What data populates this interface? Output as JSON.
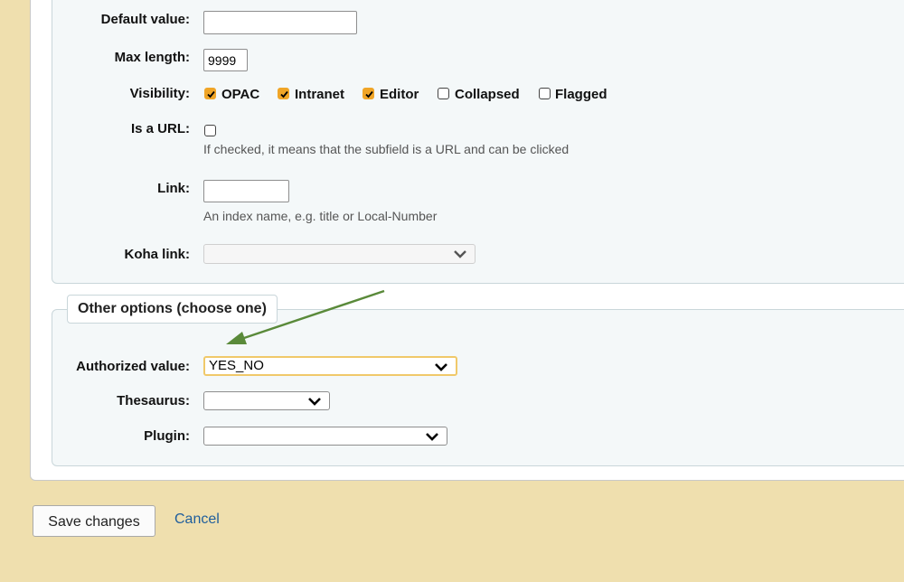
{
  "form": {
    "default_value": {
      "label": "Default value:",
      "value": ""
    },
    "max_length": {
      "label": "Max length:",
      "value": "9999"
    },
    "visibility": {
      "label": "Visibility:",
      "options": [
        {
          "label": "OPAC",
          "checked": true
        },
        {
          "label": "Intranet",
          "checked": true
        },
        {
          "label": "Editor",
          "checked": true
        },
        {
          "label": "Collapsed",
          "checked": false
        },
        {
          "label": "Flagged",
          "checked": false
        }
      ]
    },
    "is_url": {
      "label": "Is a URL:",
      "checked": false,
      "hint": "If checked, it means that the subfield is a URL and can be clicked"
    },
    "link": {
      "label": "Link:",
      "value": "",
      "hint": "An index name, e.g. title or Local-Number"
    },
    "koha_link": {
      "label": "Koha link:",
      "value": ""
    }
  },
  "other_options": {
    "legend": "Other options (choose one)",
    "authorized_value": {
      "label": "Authorized value:",
      "value": "YES_NO"
    },
    "thesaurus": {
      "label": "Thesaurus:",
      "value": ""
    },
    "plugin": {
      "label": "Plugin:",
      "value": ""
    }
  },
  "actions": {
    "save_label": "Save changes",
    "cancel_label": "Cancel"
  },
  "colors": {
    "page_background": "#efdfae",
    "fieldset_background": "#f4f8f9",
    "checkbox_checked": "#f0a527",
    "focus_border": "#f0c96a",
    "annotation_arrow": "#5a8a3a",
    "link": "#1f5e9c"
  },
  "icons": [
    "checkmark-icon",
    "chevron-down-icon",
    "annotation-arrow"
  ]
}
